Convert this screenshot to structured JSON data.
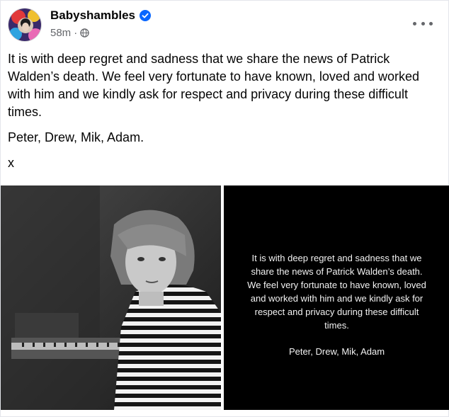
{
  "post": {
    "page_name": "Babyshambles",
    "timestamp": "58m",
    "separator": "·",
    "body": [
      "It is with deep regret and sadness that we share the news of Patrick Walden’s death. We feel very fortunate to have known, loved and worked with him and we kindly ask for respect and privacy during these difficult times.",
      "Peter, Drew, Mik, Adam.",
      "x"
    ]
  },
  "media": {
    "overlay_text": "It is with deep regret and sadness that we share the news of Patrick Walden’s death. We feel very fortunate to have known, loved and worked with him and we kindly ask for respect and privacy during these difficult times.",
    "overlay_signature": "Peter, Drew, Mik, Adam"
  },
  "icons": {
    "verified": "verified-badge-icon",
    "audience": "globe-icon",
    "more": "more-options-icon"
  },
  "colors": {
    "verified_blue": "#0866ff",
    "meta_gray": "#65676b",
    "text": "#050505"
  }
}
